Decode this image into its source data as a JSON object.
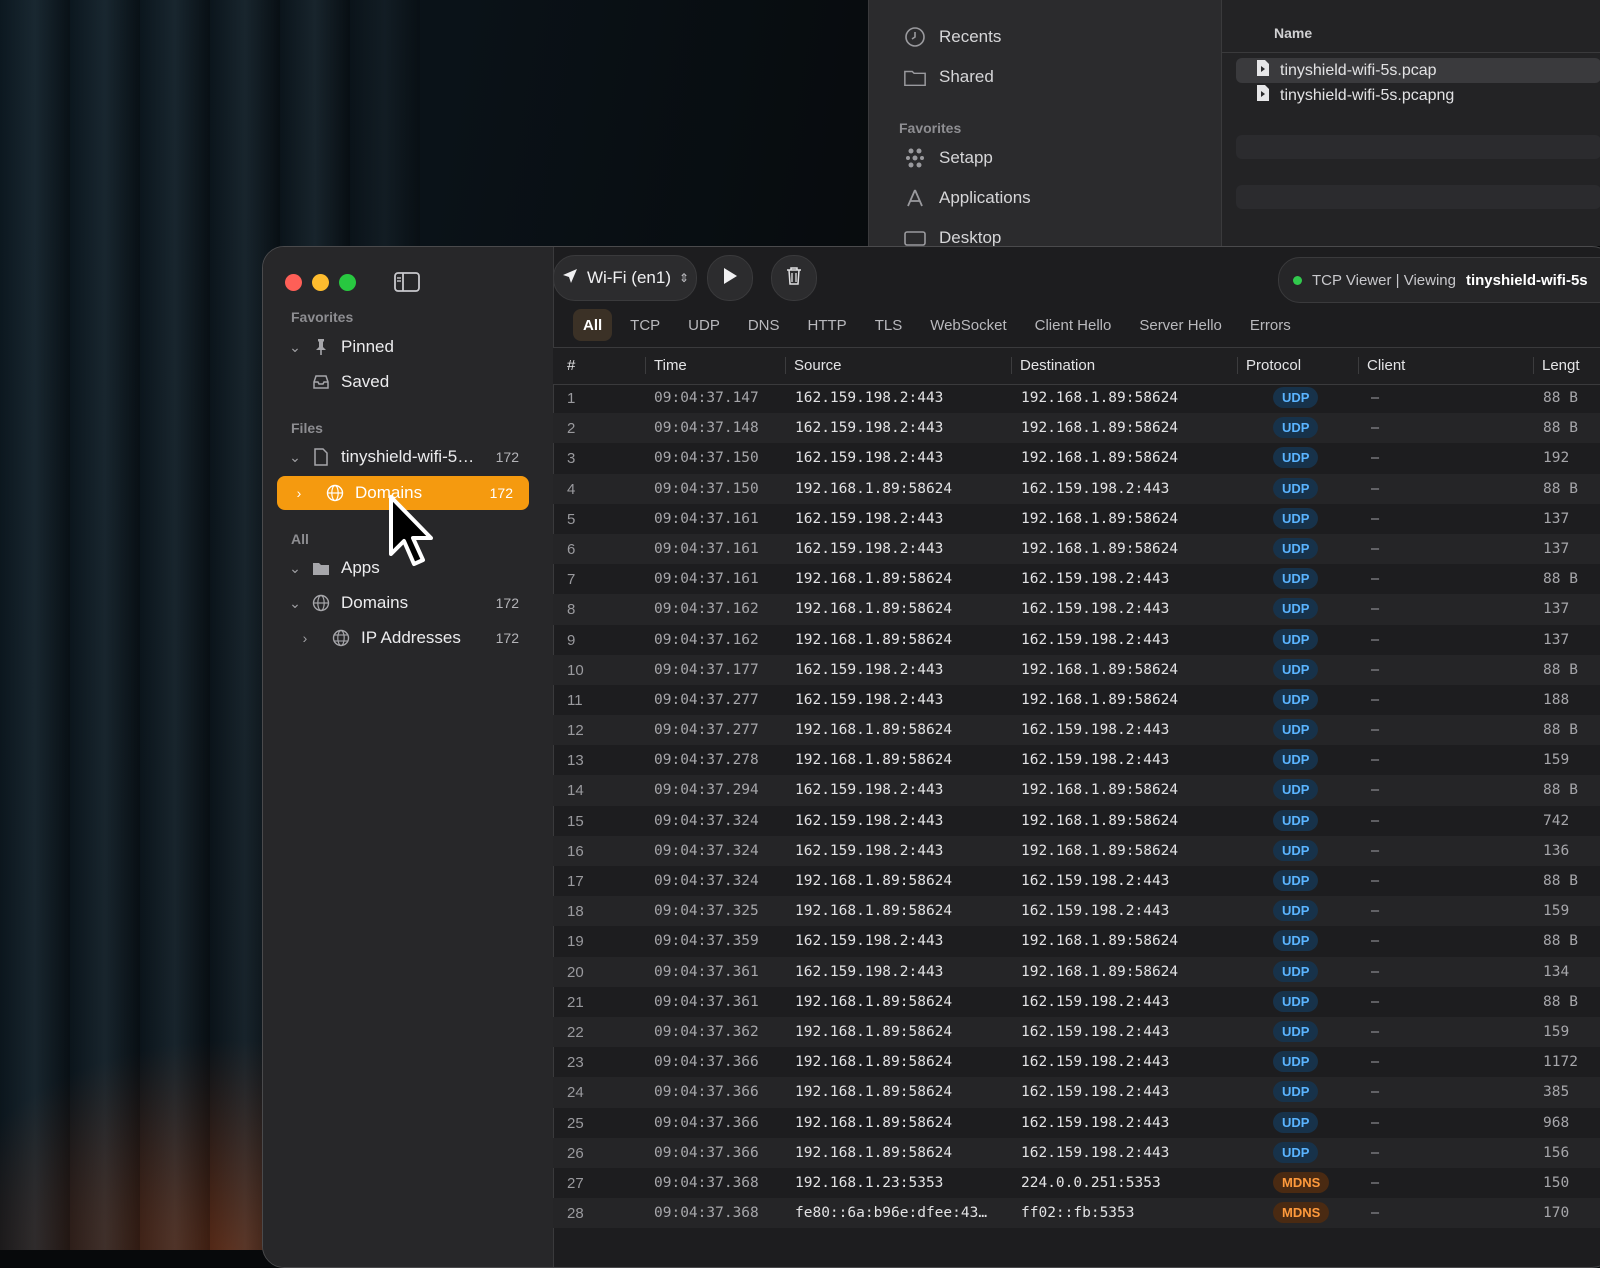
{
  "finder": {
    "sidebar_items": [
      {
        "label": "Recents",
        "icon": "clock-icon"
      },
      {
        "label": "Shared",
        "icon": "shared-folder-icon"
      }
    ],
    "favorites_heading": "Favorites",
    "favorite_items": [
      {
        "label": "Setapp",
        "icon": "setapp-icon"
      },
      {
        "label": "Applications",
        "icon": "applications-icon"
      },
      {
        "label": "Desktop",
        "icon": "desktop-icon"
      }
    ],
    "column_name": "Name",
    "files": [
      {
        "name": "tinyshield-wifi-5s.pcap",
        "selected": true
      },
      {
        "name": "tinyshield-wifi-5s.pcapng",
        "selected": false
      }
    ]
  },
  "sidebar": {
    "favorites_heading": "Favorites",
    "favorites": [
      {
        "label": "Pinned",
        "icon": "pin-icon"
      },
      {
        "label": "Saved",
        "icon": "tray-icon"
      }
    ],
    "files_heading": "Files",
    "file": {
      "label": "tinyshield-wifi-5s...",
      "count": "172"
    },
    "file_child": {
      "label": "Domains",
      "count": "172"
    },
    "all_heading": "All",
    "all_items": [
      {
        "label": "Apps",
        "count": ""
      },
      {
        "label": "Domains",
        "count": "172"
      },
      {
        "label": "IP Addresses",
        "count": "172"
      }
    ]
  },
  "toolbar": {
    "interface": "Wi-Fi (en1)",
    "status_prefix": "TCP Viewer | Viewing",
    "status_file": "tinyshield-wifi-5s"
  },
  "filters": [
    "All",
    "TCP",
    "UDP",
    "DNS",
    "HTTP",
    "TLS",
    "WebSocket",
    "Client Hello",
    "Server Hello",
    "Errors"
  ],
  "table": {
    "columns": [
      "#",
      "Time",
      "Source",
      "Destination",
      "Protocol",
      "Client",
      "Lengt"
    ],
    "rows": [
      [
        "1",
        "09:04:37.147",
        "162.159.198.2:443",
        "192.168.1.89:58624",
        "UDP",
        "–",
        "88 B"
      ],
      [
        "2",
        "09:04:37.148",
        "162.159.198.2:443",
        "192.168.1.89:58624",
        "UDP",
        "–",
        "88 B"
      ],
      [
        "3",
        "09:04:37.150",
        "162.159.198.2:443",
        "192.168.1.89:58624",
        "UDP",
        "–",
        "192"
      ],
      [
        "4",
        "09:04:37.150",
        "192.168.1.89:58624",
        "162.159.198.2:443",
        "UDP",
        "–",
        "88 B"
      ],
      [
        "5",
        "09:04:37.161",
        "162.159.198.2:443",
        "192.168.1.89:58624",
        "UDP",
        "–",
        "137"
      ],
      [
        "6",
        "09:04:37.161",
        "162.159.198.2:443",
        "192.168.1.89:58624",
        "UDP",
        "–",
        "137"
      ],
      [
        "7",
        "09:04:37.161",
        "192.168.1.89:58624",
        "162.159.198.2:443",
        "UDP",
        "–",
        "88 B"
      ],
      [
        "8",
        "09:04:37.162",
        "192.168.1.89:58624",
        "162.159.198.2:443",
        "UDP",
        "–",
        "137"
      ],
      [
        "9",
        "09:04:37.162",
        "192.168.1.89:58624",
        "162.159.198.2:443",
        "UDP",
        "–",
        "137"
      ],
      [
        "10",
        "09:04:37.177",
        "162.159.198.2:443",
        "192.168.1.89:58624",
        "UDP",
        "–",
        "88 B"
      ],
      [
        "11",
        "09:04:37.277",
        "162.159.198.2:443",
        "192.168.1.89:58624",
        "UDP",
        "–",
        "188"
      ],
      [
        "12",
        "09:04:37.277",
        "192.168.1.89:58624",
        "162.159.198.2:443",
        "UDP",
        "–",
        "88 B"
      ],
      [
        "13",
        "09:04:37.278",
        "192.168.1.89:58624",
        "162.159.198.2:443",
        "UDP",
        "–",
        "159"
      ],
      [
        "14",
        "09:04:37.294",
        "162.159.198.2:443",
        "192.168.1.89:58624",
        "UDP",
        "–",
        "88 B"
      ],
      [
        "15",
        "09:04:37.324",
        "162.159.198.2:443",
        "192.168.1.89:58624",
        "UDP",
        "–",
        "742"
      ],
      [
        "16",
        "09:04:37.324",
        "162.159.198.2:443",
        "192.168.1.89:58624",
        "UDP",
        "–",
        "136"
      ],
      [
        "17",
        "09:04:37.324",
        "192.168.1.89:58624",
        "162.159.198.2:443",
        "UDP",
        "–",
        "88 B"
      ],
      [
        "18",
        "09:04:37.325",
        "192.168.1.89:58624",
        "162.159.198.2:443",
        "UDP",
        "–",
        "159"
      ],
      [
        "19",
        "09:04:37.359",
        "162.159.198.2:443",
        "192.168.1.89:58624",
        "UDP",
        "–",
        "88 B"
      ],
      [
        "20",
        "09:04:37.361",
        "162.159.198.2:443",
        "192.168.1.89:58624",
        "UDP",
        "–",
        "134"
      ],
      [
        "21",
        "09:04:37.361",
        "192.168.1.89:58624",
        "162.159.198.2:443",
        "UDP",
        "–",
        "88 B"
      ],
      [
        "22",
        "09:04:37.362",
        "192.168.1.89:58624",
        "162.159.198.2:443",
        "UDP",
        "–",
        "159"
      ],
      [
        "23",
        "09:04:37.366",
        "192.168.1.89:58624",
        "162.159.198.2:443",
        "UDP",
        "–",
        "1172"
      ],
      [
        "24",
        "09:04:37.366",
        "192.168.1.89:58624",
        "162.159.198.2:443",
        "UDP",
        "–",
        "385"
      ],
      [
        "25",
        "09:04:37.366",
        "192.168.1.89:58624",
        "162.159.198.2:443",
        "UDP",
        "–",
        "968"
      ],
      [
        "26",
        "09:04:37.366",
        "192.168.1.89:58624",
        "162.159.198.2:443",
        "UDP",
        "–",
        "156"
      ],
      [
        "27",
        "09:04:37.368",
        "192.168.1.23:5353",
        "224.0.0.251:5353",
        "MDNS",
        "–",
        "150"
      ],
      [
        "28",
        "09:04:37.368",
        "fe80::6a:b96e:dfee:43…",
        "ff02::fb:5353",
        "MDNS",
        "–",
        "170"
      ]
    ]
  },
  "colors": {
    "accent": "#f59a0f",
    "udp_text": "#5ab4ff",
    "udp_bg": "#17324a",
    "mdns_text": "#ff9a3c",
    "mdns_bg": "#4a2a12",
    "traffic_red": "#fe5f57",
    "traffic_yellow": "#febc2e",
    "traffic_green": "#28c840"
  }
}
